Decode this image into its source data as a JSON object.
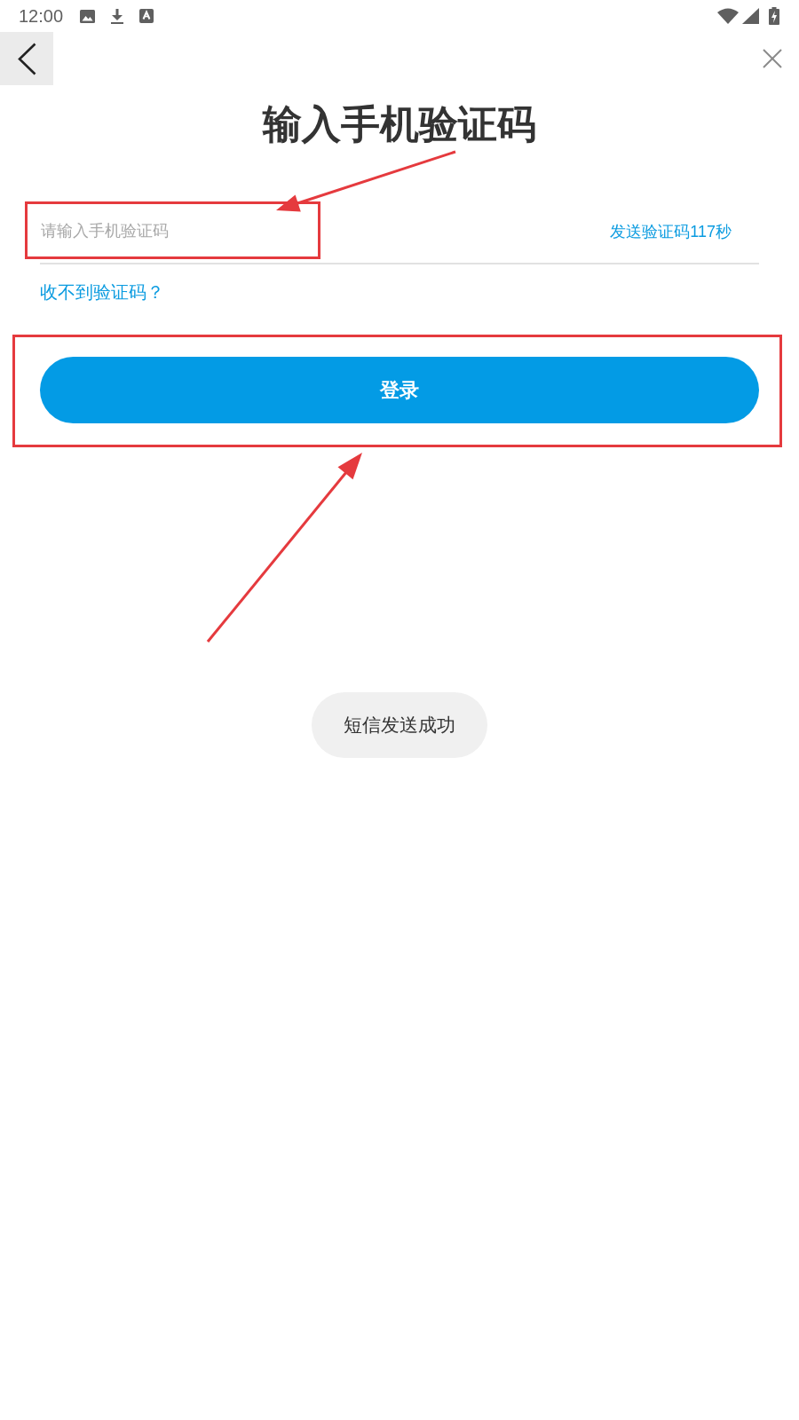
{
  "status_bar": {
    "time": "12:00"
  },
  "title": "输入手机验证码",
  "code_field": {
    "placeholder": "请输入手机验证码"
  },
  "send_code_button": "发送验证码117秒",
  "help_link": "收不到验证码？",
  "login_button": "登录",
  "toast": "短信发送成功"
}
